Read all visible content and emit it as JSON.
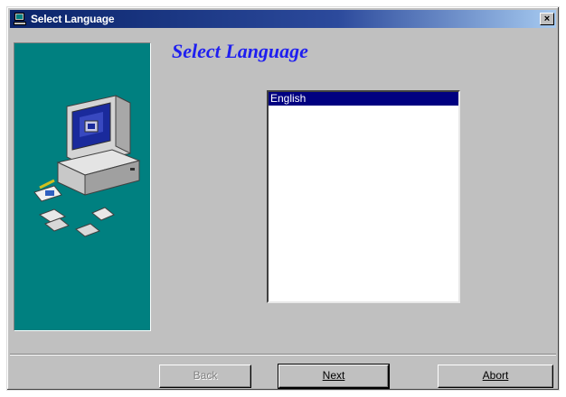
{
  "window": {
    "title": "Select Language",
    "close_label": "×"
  },
  "main": {
    "heading": "Select Language",
    "languages": [
      {
        "label": "English",
        "selected": true
      }
    ]
  },
  "buttons": {
    "back": "Back",
    "next": "Next",
    "abort": "Abort"
  },
  "colors": {
    "side_panel": "#008080",
    "selection": "#000080",
    "heading": "#1f1ff0",
    "titlebar_start": "#0a246a"
  }
}
